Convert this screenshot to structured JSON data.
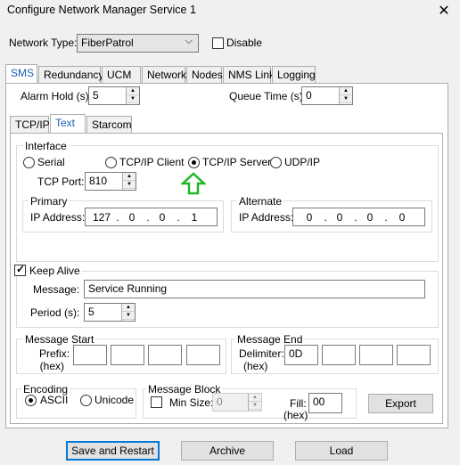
{
  "window": {
    "title": "Configure Network Manager Service 1",
    "close_glyph": "✕"
  },
  "network_type": {
    "label": "Network Type:",
    "value": "FiberPatrol",
    "disable_label": "Disable",
    "disable_checked": false
  },
  "main_tabs": [
    "SMS",
    "Redundancy",
    "UCM",
    "Network",
    "Nodes",
    "NMS Link",
    "Logging"
  ],
  "main_active_tab": "SMS",
  "alarm_hold": {
    "label": "Alarm Hold (s):",
    "value": "5"
  },
  "queue_time": {
    "label": "Queue Time (s):",
    "value": "0"
  },
  "sub_tabs": [
    "TCP/IP",
    "Text",
    "Starcom"
  ],
  "sub_active_tab": "Text",
  "interface": {
    "label": "Interface",
    "options": [
      "Serial",
      "TCP/IP Client",
      "TCP/IP Server",
      "UDP/IP"
    ],
    "selected": "TCP/IP Server",
    "tcp_port_label": "TCP Port:",
    "tcp_port": "810"
  },
  "primary": {
    "label": "Primary",
    "ip_label": "IP Address:",
    "ip": [
      "127",
      "0",
      "0",
      "1"
    ]
  },
  "alternate": {
    "label": "Alternate",
    "ip_label": "IP Address:",
    "ip": [
      "0",
      "0",
      "0",
      "0"
    ]
  },
  "keep_alive": {
    "label": "Keep Alive",
    "checked": true,
    "message_label": "Message:",
    "message": "Service Running",
    "period_label": "Period (s):",
    "period": "5"
  },
  "message_start": {
    "label": "Message Start",
    "prefix_label": "Prefix:",
    "prefix_sub": "(hex)",
    "fields": [
      "",
      "",
      "",
      ""
    ]
  },
  "message_end": {
    "label": "Message End",
    "delimiter_label": "Delimiter:",
    "delimiter_sub": "(hex)",
    "fields": [
      "0D",
      "",
      "",
      ""
    ]
  },
  "encoding": {
    "label": "Encoding",
    "options": [
      "ASCII",
      "Unicode"
    ],
    "selected": "ASCII"
  },
  "message_block": {
    "label": "Message Block",
    "min_size_label": "Min Size:",
    "min_size": "0",
    "fill_label": "Fill:",
    "fill_sub": "(hex)",
    "fill": "00",
    "checked": false
  },
  "buttons": {
    "export": "Export",
    "save_restart": "Save and Restart",
    "archive": "Archive",
    "load": "Load"
  },
  "colors": {
    "accent": "#0078d7",
    "arrow": "#1fb82a",
    "tab_text": "#1a5fb4"
  },
  "icons": {
    "arrow": "up-arrow-icon",
    "close": "close-icon"
  }
}
